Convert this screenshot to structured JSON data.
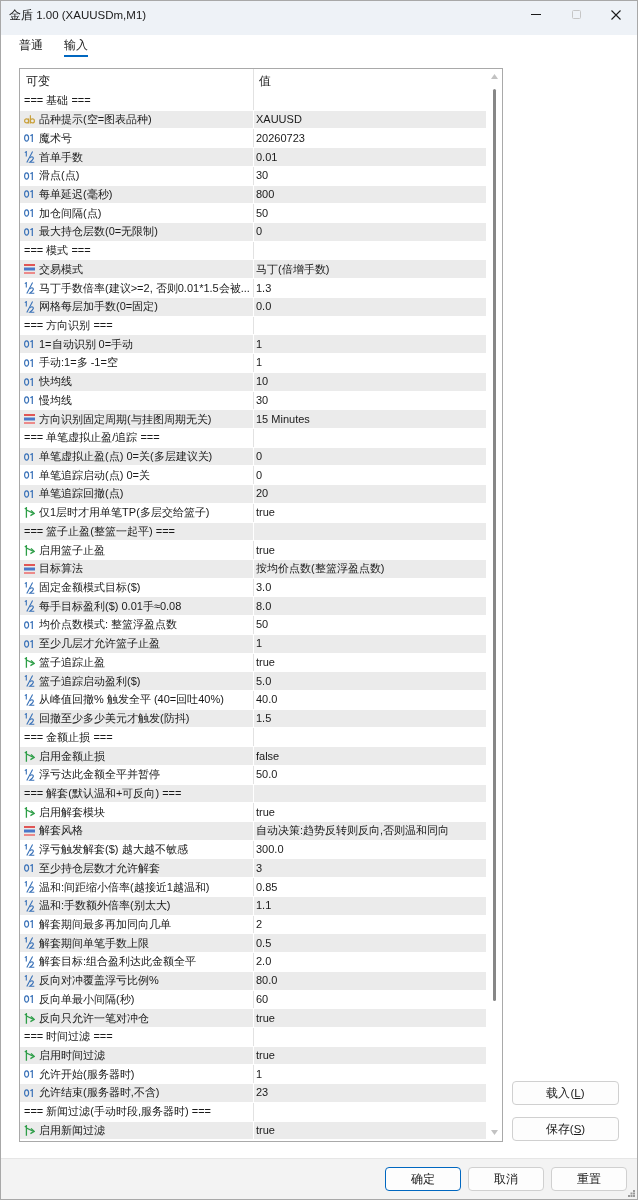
{
  "window": {
    "title": "金盾 1.00 (XAUUSDm,M1)",
    "maximize_disabled": true
  },
  "tabs": [
    {
      "label": "普通",
      "selected": false
    },
    {
      "label": "输入",
      "selected": true
    }
  ],
  "table": {
    "columns": [
      "可变",
      "值"
    ],
    "rows": [
      {
        "kind": "group",
        "label": "=== 基础 ==="
      },
      {
        "kind": "string",
        "name": "品种提示(空=图表品种)",
        "value": "XAUUSD"
      },
      {
        "kind": "int",
        "name": "魔术号",
        "value": "20260723"
      },
      {
        "kind": "double",
        "name": "首单手数",
        "value": "0.01"
      },
      {
        "kind": "int",
        "name": "滑点(点)",
        "value": "30"
      },
      {
        "kind": "int",
        "name": "每单延迟(毫秒)",
        "value": "800"
      },
      {
        "kind": "int",
        "name": "加仓间隔(点)",
        "value": "50"
      },
      {
        "kind": "int",
        "name": "最大持仓层数(0=无限制)",
        "value": "0"
      },
      {
        "kind": "group",
        "label": "=== 模式 ==="
      },
      {
        "kind": "enum",
        "name": "交易模式",
        "value": "马丁(倍增手数)"
      },
      {
        "kind": "double",
        "name": "马丁手数倍率(建议>=2, 否则0.01*1.5会被...",
        "value": "1.3"
      },
      {
        "kind": "double",
        "name": "网格每层加手数(0=固定)",
        "value": "0.0"
      },
      {
        "kind": "group",
        "label": "=== 方向识别 ==="
      },
      {
        "kind": "int",
        "name": "1=自动识别 0=手动",
        "value": "1"
      },
      {
        "kind": "int",
        "name": "手动:1=多 -1=空",
        "value": "1"
      },
      {
        "kind": "int",
        "name": "快均线",
        "value": "10"
      },
      {
        "kind": "int",
        "name": "慢均线",
        "value": "30"
      },
      {
        "kind": "enum",
        "name": "方向识别固定周期(与挂图周期无关)",
        "value": "15 Minutes"
      },
      {
        "kind": "group",
        "label": "=== 单笔虚拟止盈/追踪 ==="
      },
      {
        "kind": "int",
        "name": "单笔虚拟止盈(点) 0=关(多层建议关)",
        "value": "0"
      },
      {
        "kind": "int",
        "name": "单笔追踪启动(点) 0=关",
        "value": "0"
      },
      {
        "kind": "int",
        "name": "单笔追踪回撤(点)",
        "value": "20"
      },
      {
        "kind": "bool",
        "name": "仅1层时才用单笔TP(多层交给篮子)",
        "value": "true"
      },
      {
        "kind": "group",
        "label": "=== 篮子止盈(整篮一起平) ==="
      },
      {
        "kind": "bool",
        "name": "启用篮子止盈",
        "value": "true"
      },
      {
        "kind": "enum",
        "name": "目标算法",
        "value": "按均价点数(整篮浮盈点数)"
      },
      {
        "kind": "double",
        "name": "固定金额模式目标($)",
        "value": "3.0"
      },
      {
        "kind": "double",
        "name": "每手目标盈利($) 0.01手≈0.08",
        "value": "8.0"
      },
      {
        "kind": "int",
        "name": "均价点数模式: 整篮浮盈点数",
        "value": "50"
      },
      {
        "kind": "int",
        "name": "至少几层才允许篮子止盈",
        "value": "1"
      },
      {
        "kind": "bool",
        "name": "篮子追踪止盈",
        "value": "true"
      },
      {
        "kind": "double",
        "name": "篮子追踪启动盈利($)",
        "value": "5.0"
      },
      {
        "kind": "double",
        "name": "从峰值回撤% 触发全平 (40=回吐40%)",
        "value": "40.0"
      },
      {
        "kind": "double",
        "name": "回撤至少多少美元才触发(防抖)",
        "value": "1.5"
      },
      {
        "kind": "group",
        "label": "=== 金额止损 ==="
      },
      {
        "kind": "bool",
        "name": "启用金额止损",
        "value": "false"
      },
      {
        "kind": "double",
        "name": "浮亏达此金额全平并暂停",
        "value": "50.0"
      },
      {
        "kind": "group",
        "label": "=== 解套(默认温和+可反向) ==="
      },
      {
        "kind": "bool",
        "name": "启用解套模块",
        "value": "true"
      },
      {
        "kind": "enum",
        "name": "解套风格",
        "value": "自动决策:趋势反转则反向,否则温和同向"
      },
      {
        "kind": "double",
        "name": "浮亏触发解套($) 越大越不敏感",
        "value": "300.0"
      },
      {
        "kind": "int",
        "name": "至少持仓层数才允许解套",
        "value": "3"
      },
      {
        "kind": "double",
        "name": "温和:间距缩小倍率(越接近1越温和)",
        "value": "0.85"
      },
      {
        "kind": "double",
        "name": "温和:手数额外倍率(别太大)",
        "value": "1.1"
      },
      {
        "kind": "int",
        "name": "解套期间最多再加同向几单",
        "value": "2"
      },
      {
        "kind": "double",
        "name": "解套期间单笔手数上限",
        "value": "0.5"
      },
      {
        "kind": "double",
        "name": "解套目标:组合盈利达此金额全平",
        "value": "2.0"
      },
      {
        "kind": "double",
        "name": "反向对冲覆盖浮亏比例%",
        "value": "80.0"
      },
      {
        "kind": "int",
        "name": "反向单最小间隔(秒)",
        "value": "60"
      },
      {
        "kind": "bool",
        "name": "反向只允许一笔对冲仓",
        "value": "true"
      },
      {
        "kind": "group",
        "label": "=== 时间过滤 ==="
      },
      {
        "kind": "bool",
        "name": "启用时间过滤",
        "value": "true"
      },
      {
        "kind": "int",
        "name": "允许开始(服务器时)",
        "value": "1"
      },
      {
        "kind": "int",
        "name": "允许结束(服务器时,不含)",
        "value": "23"
      },
      {
        "kind": "group",
        "label": "=== 新闻过滤(手动时段,服务器时) ==="
      },
      {
        "kind": "bool",
        "name": "启用新闻过滤",
        "value": "true"
      }
    ]
  },
  "side_buttons": [
    {
      "label": "载入(",
      "access_key": "L",
      "label_end": ")"
    },
    {
      "label": "保存(",
      "access_key": "S",
      "label_end": ")"
    }
  ],
  "buttons": [
    {
      "label": "确定",
      "default": true
    },
    {
      "label": "取消",
      "default": false
    },
    {
      "label": "重置",
      "default": false
    }
  ]
}
